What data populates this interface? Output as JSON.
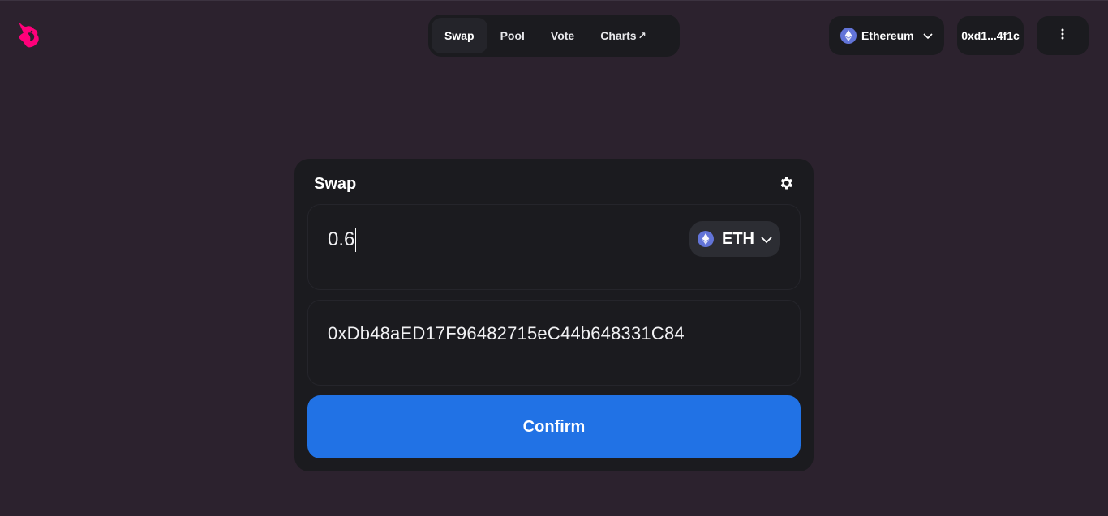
{
  "header": {
    "logo_icon": "uniswap-unicorn-icon",
    "nav": [
      {
        "label": "Swap",
        "active": true
      },
      {
        "label": "Pool",
        "active": false
      },
      {
        "label": "Vote",
        "active": false
      },
      {
        "label": "Charts",
        "external": true,
        "suffix": "↗"
      }
    ],
    "network": {
      "label": "Ethereum",
      "icon": "ethereum-icon"
    },
    "account": {
      "label": "0xd1...4f1c"
    },
    "more_icon": "more-vertical-icon"
  },
  "swap": {
    "title": "Swap",
    "settings_icon": "gear-icon",
    "input_amount": "0.6",
    "token": {
      "symbol": "ETH",
      "icon": "ethereum-icon"
    },
    "recipient_address": "0xDb48aED17F96482715eC44b648331C84",
    "confirm_label": "Confirm"
  },
  "colors": {
    "background": "#2c222e",
    "surface": "#1b1b1f",
    "accent": "#2172e5",
    "brand_pink": "#ff007a",
    "eth_purple": "#6274d8"
  }
}
